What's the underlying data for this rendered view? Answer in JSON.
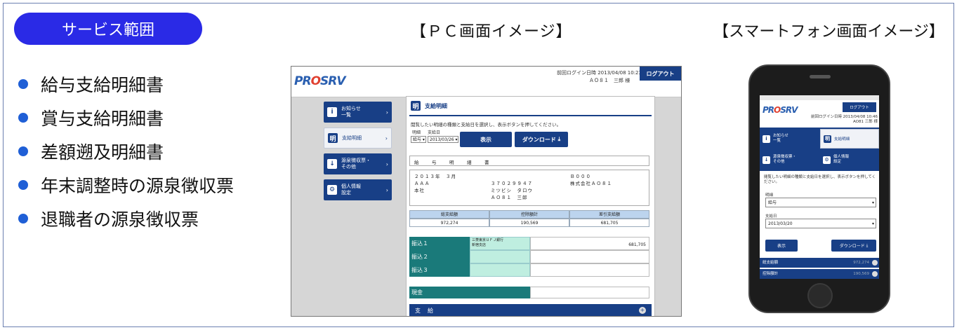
{
  "service_pill": "サービス範囲",
  "services": [
    "給与支給明細書",
    "賞与支給明細書",
    "差額遡及明細書",
    "年末調整時の源泉徴収票",
    "退職者の源泉徴収票"
  ],
  "headings": {
    "pc": "【ＰＣ画面イメージ】",
    "smartphone": "【スマートフォン画面イメージ】"
  },
  "pc": {
    "logo": {
      "pre": "PR",
      "o": "O",
      "post": "SRV"
    },
    "login_info": "前回ログイン日時  2013/04/08 10:23",
    "user": "ＡＯ８１　三郎 様",
    "logout": "ログアウト",
    "menu": [
      {
        "icon": "i",
        "label": "お知らせ\n一覧"
      },
      {
        "icon": "明",
        "label": "支給明細"
      },
      {
        "icon": "↓",
        "label": "源泉徴収票・\nその他"
      },
      {
        "icon": "⚙",
        "label": "個人情報\n設定"
      }
    ],
    "title": "支給明細",
    "instruction": "閲覧したい明細の種類と支給日を選択し、表示ボタンを押してください。",
    "type_label": "明細",
    "date_label": "支給日",
    "type_value": "給与",
    "date_value": "2013/03/26",
    "show_button": "表示",
    "download_button": "ダウンロード",
    "doc_title": "給　与　明　細　書",
    "info": {
      "period": "２０１３年　３月",
      "company_code": "ＡＡＡ",
      "office": "本社",
      "emp_no": "３７０２９９４７",
      "kana": "ミツビシ　タロウ",
      "name": "ＡＯ８１　三郎",
      "dept_code": "Ｂ０００",
      "company": "株式会社ＡＯ８１"
    },
    "summary_headers": [
      "総支給額",
      "控除額計",
      "差引支給額"
    ],
    "summary_values": [
      "972,274",
      "190,569",
      "681,705"
    ],
    "banks": [
      {
        "label": "振込１",
        "bank": "三菱東京ＵＦＪ銀行",
        "branch": "新宿支店",
        "amount": "681,705"
      },
      {
        "label": "振込２",
        "bank": "",
        "branch": "",
        "amount": ""
      },
      {
        "label": "振込３",
        "bank": "",
        "branch": "",
        "amount": ""
      }
    ],
    "cash_label": "現金",
    "pay_bar": "支給"
  },
  "sp": {
    "logo": {
      "pre": "PR",
      "o": "O",
      "post": "SRV"
    },
    "logout": "ログアウト",
    "login_info": "前回ログイン日時  2013/04/08 10:46",
    "user": "AO81  三郎 様",
    "menu": [
      {
        "icon": "i",
        "label": "お知らせ\n一覧"
      },
      {
        "icon": "明",
        "label": "支給明細"
      },
      {
        "icon": "↓",
        "label": "源泉徴収票・\nその他"
      },
      {
        "icon": "⚙",
        "label": "個人情報\n設定"
      }
    ],
    "instruction": "閲覧したい明細の種類と支給日を選択し、表示ボタンを押してください。",
    "type_label": "明細",
    "type_value": "給与",
    "date_label": "支給日",
    "date_value": "2013/03/20",
    "show_button": "表示",
    "download_button": "ダウンロード",
    "rows": [
      {
        "label": "総支給額",
        "value": "972,274"
      },
      {
        "label": "控除額計",
        "value": "190,569"
      }
    ]
  },
  "colors": {
    "pill": "#2a2ae6",
    "dot": "#1f5fd6",
    "navy": "#183f86",
    "teal": "#1a7a7a"
  }
}
